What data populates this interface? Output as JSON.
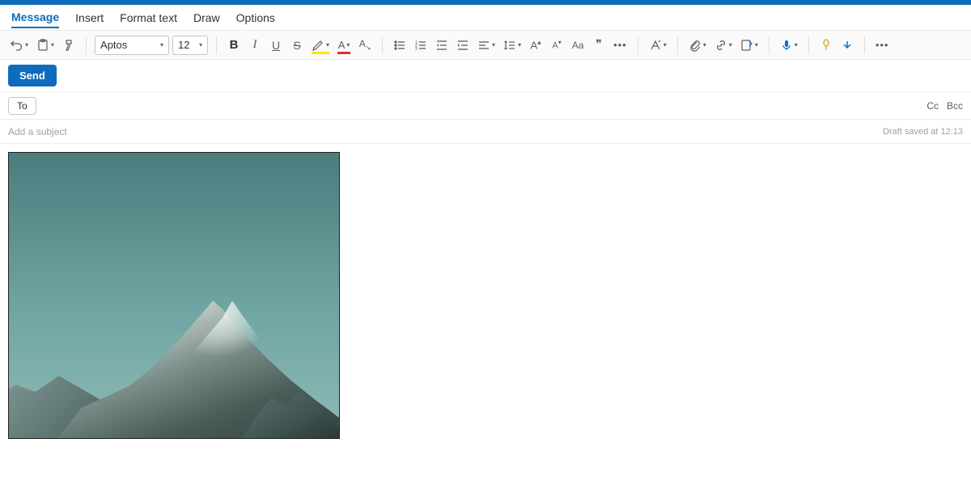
{
  "tabs": [
    "Message",
    "Insert",
    "Format text",
    "Draw",
    "Options"
  ],
  "active_tab": 0,
  "ribbon": {
    "font_name": "Aptos",
    "font_size": "12"
  },
  "send_label": "Send",
  "to_label": "To",
  "cc_label": "Cc",
  "bcc_label": "Bcc",
  "subject_placeholder": "Add a subject",
  "draft_saved": "Draft saved at 12:13",
  "image_alt": "mountain-photo"
}
